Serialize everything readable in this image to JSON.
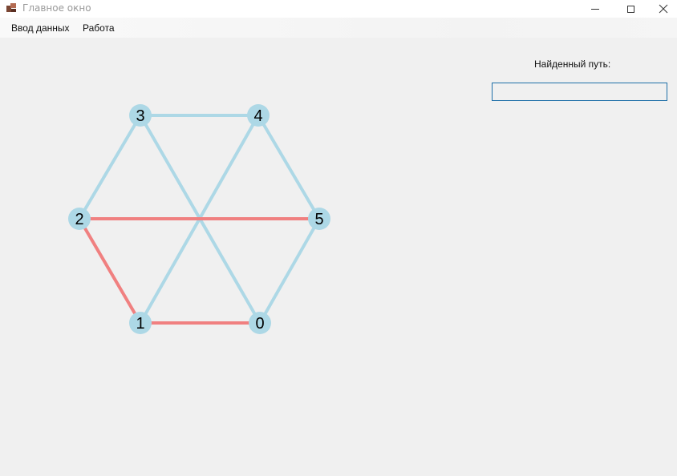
{
  "window": {
    "title": "Главное окно"
  },
  "menu": {
    "items": [
      "Ввод данных",
      "Работа"
    ]
  },
  "panel": {
    "found_path_label": "Найденный путь:",
    "found_path_value": ""
  },
  "graph": {
    "nodes": [
      "0",
      "1",
      "2",
      "3",
      "4",
      "5"
    ],
    "edges": [
      [
        "3",
        "4"
      ],
      [
        "3",
        "2"
      ],
      [
        "3",
        "0"
      ],
      [
        "4",
        "1"
      ],
      [
        "4",
        "5"
      ],
      [
        "5",
        "0"
      ],
      [
        "2",
        "5"
      ],
      [
        "2",
        "1"
      ],
      [
        "1",
        "0"
      ]
    ],
    "highlighted_path": [
      "5",
      "2",
      "1",
      "0"
    ],
    "colors": {
      "node": "#add8e6",
      "edge": "#add8e6",
      "path": "#f08080",
      "label": "#000000"
    }
  }
}
